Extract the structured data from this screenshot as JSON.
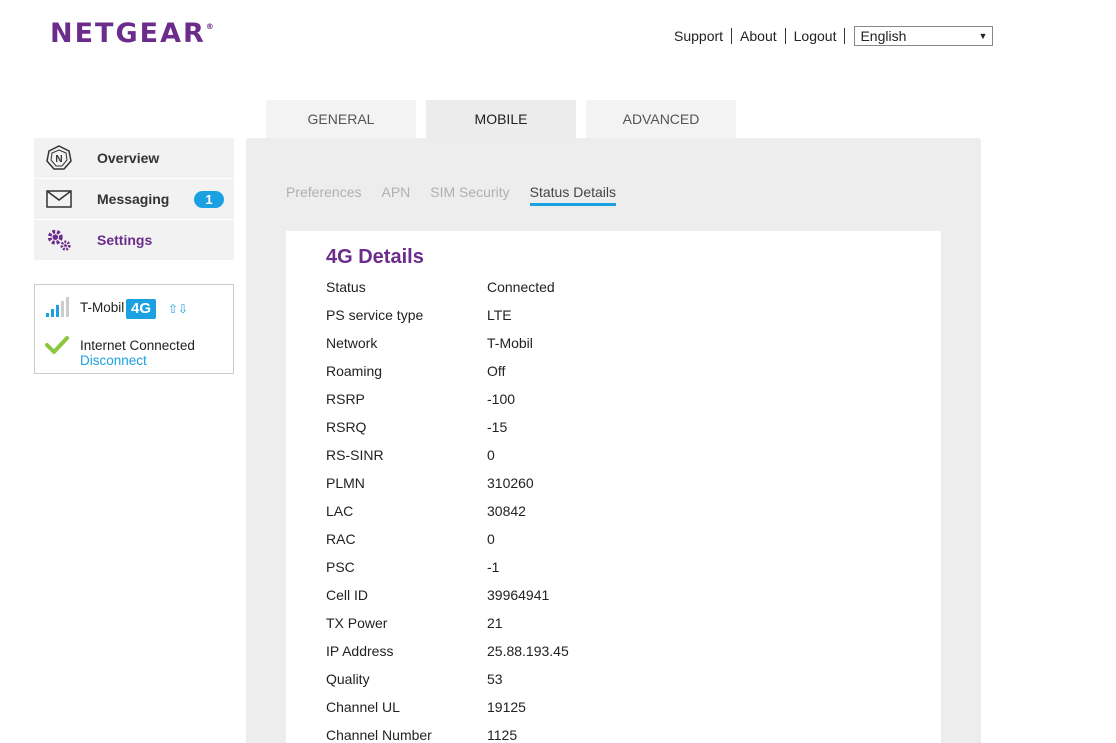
{
  "header": {
    "logo": "NETGEAR",
    "logo_mark": "®",
    "nav": [
      "Support",
      "About",
      "Logout"
    ],
    "language": "English"
  },
  "tabs": [
    {
      "label": "GENERAL",
      "active": false
    },
    {
      "label": "MOBILE",
      "active": true
    },
    {
      "label": "ADVANCED",
      "active": false
    }
  ],
  "sidebar": {
    "items": [
      {
        "label": "Overview",
        "icon": "netgear-n-icon"
      },
      {
        "label": "Messaging",
        "icon": "envelope-icon",
        "badge": "1"
      },
      {
        "label": "Settings",
        "icon": "gears-icon"
      }
    ]
  },
  "status": {
    "carrier": "T-Mobil",
    "network_type": "4G",
    "arrows": "⇧⇩",
    "internet": "Internet Connected",
    "disconnect": "Disconnect",
    "signal_bars": 3,
    "signal_bars_total": 5,
    "accent_color": "#1ba1e2"
  },
  "subtabs": [
    {
      "label": "Preferences",
      "active": false
    },
    {
      "label": "APN",
      "active": false
    },
    {
      "label": "SIM Security",
      "active": false
    },
    {
      "label": "Status Details",
      "active": true
    }
  ],
  "details": {
    "title": "4G Details",
    "rows": [
      {
        "key": "Status",
        "value": "Connected"
      },
      {
        "key": "PS service type",
        "value": "LTE"
      },
      {
        "key": "Network",
        "value": "T-Mobil"
      },
      {
        "key": "Roaming",
        "value": "Off"
      },
      {
        "key": "RSRP",
        "value": "-100"
      },
      {
        "key": "RSRQ",
        "value": "-15"
      },
      {
        "key": "RS-SINR",
        "value": "0"
      },
      {
        "key": "PLMN",
        "value": "310260"
      },
      {
        "key": "LAC",
        "value": "30842"
      },
      {
        "key": "RAC",
        "value": "0"
      },
      {
        "key": "PSC",
        "value": "-1"
      },
      {
        "key": "Cell ID",
        "value": "39964941"
      },
      {
        "key": "TX Power",
        "value": "21"
      },
      {
        "key": "IP Address",
        "value": "25.88.193.45"
      },
      {
        "key": "Quality",
        "value": "53"
      },
      {
        "key": "Channel UL",
        "value": "19125"
      },
      {
        "key": "Channel Number",
        "value": "1125"
      }
    ]
  },
  "colors": {
    "brand_purple": "#6b2c8c",
    "accent_blue": "#1ba1e2",
    "check_green": "#8dc63f"
  }
}
